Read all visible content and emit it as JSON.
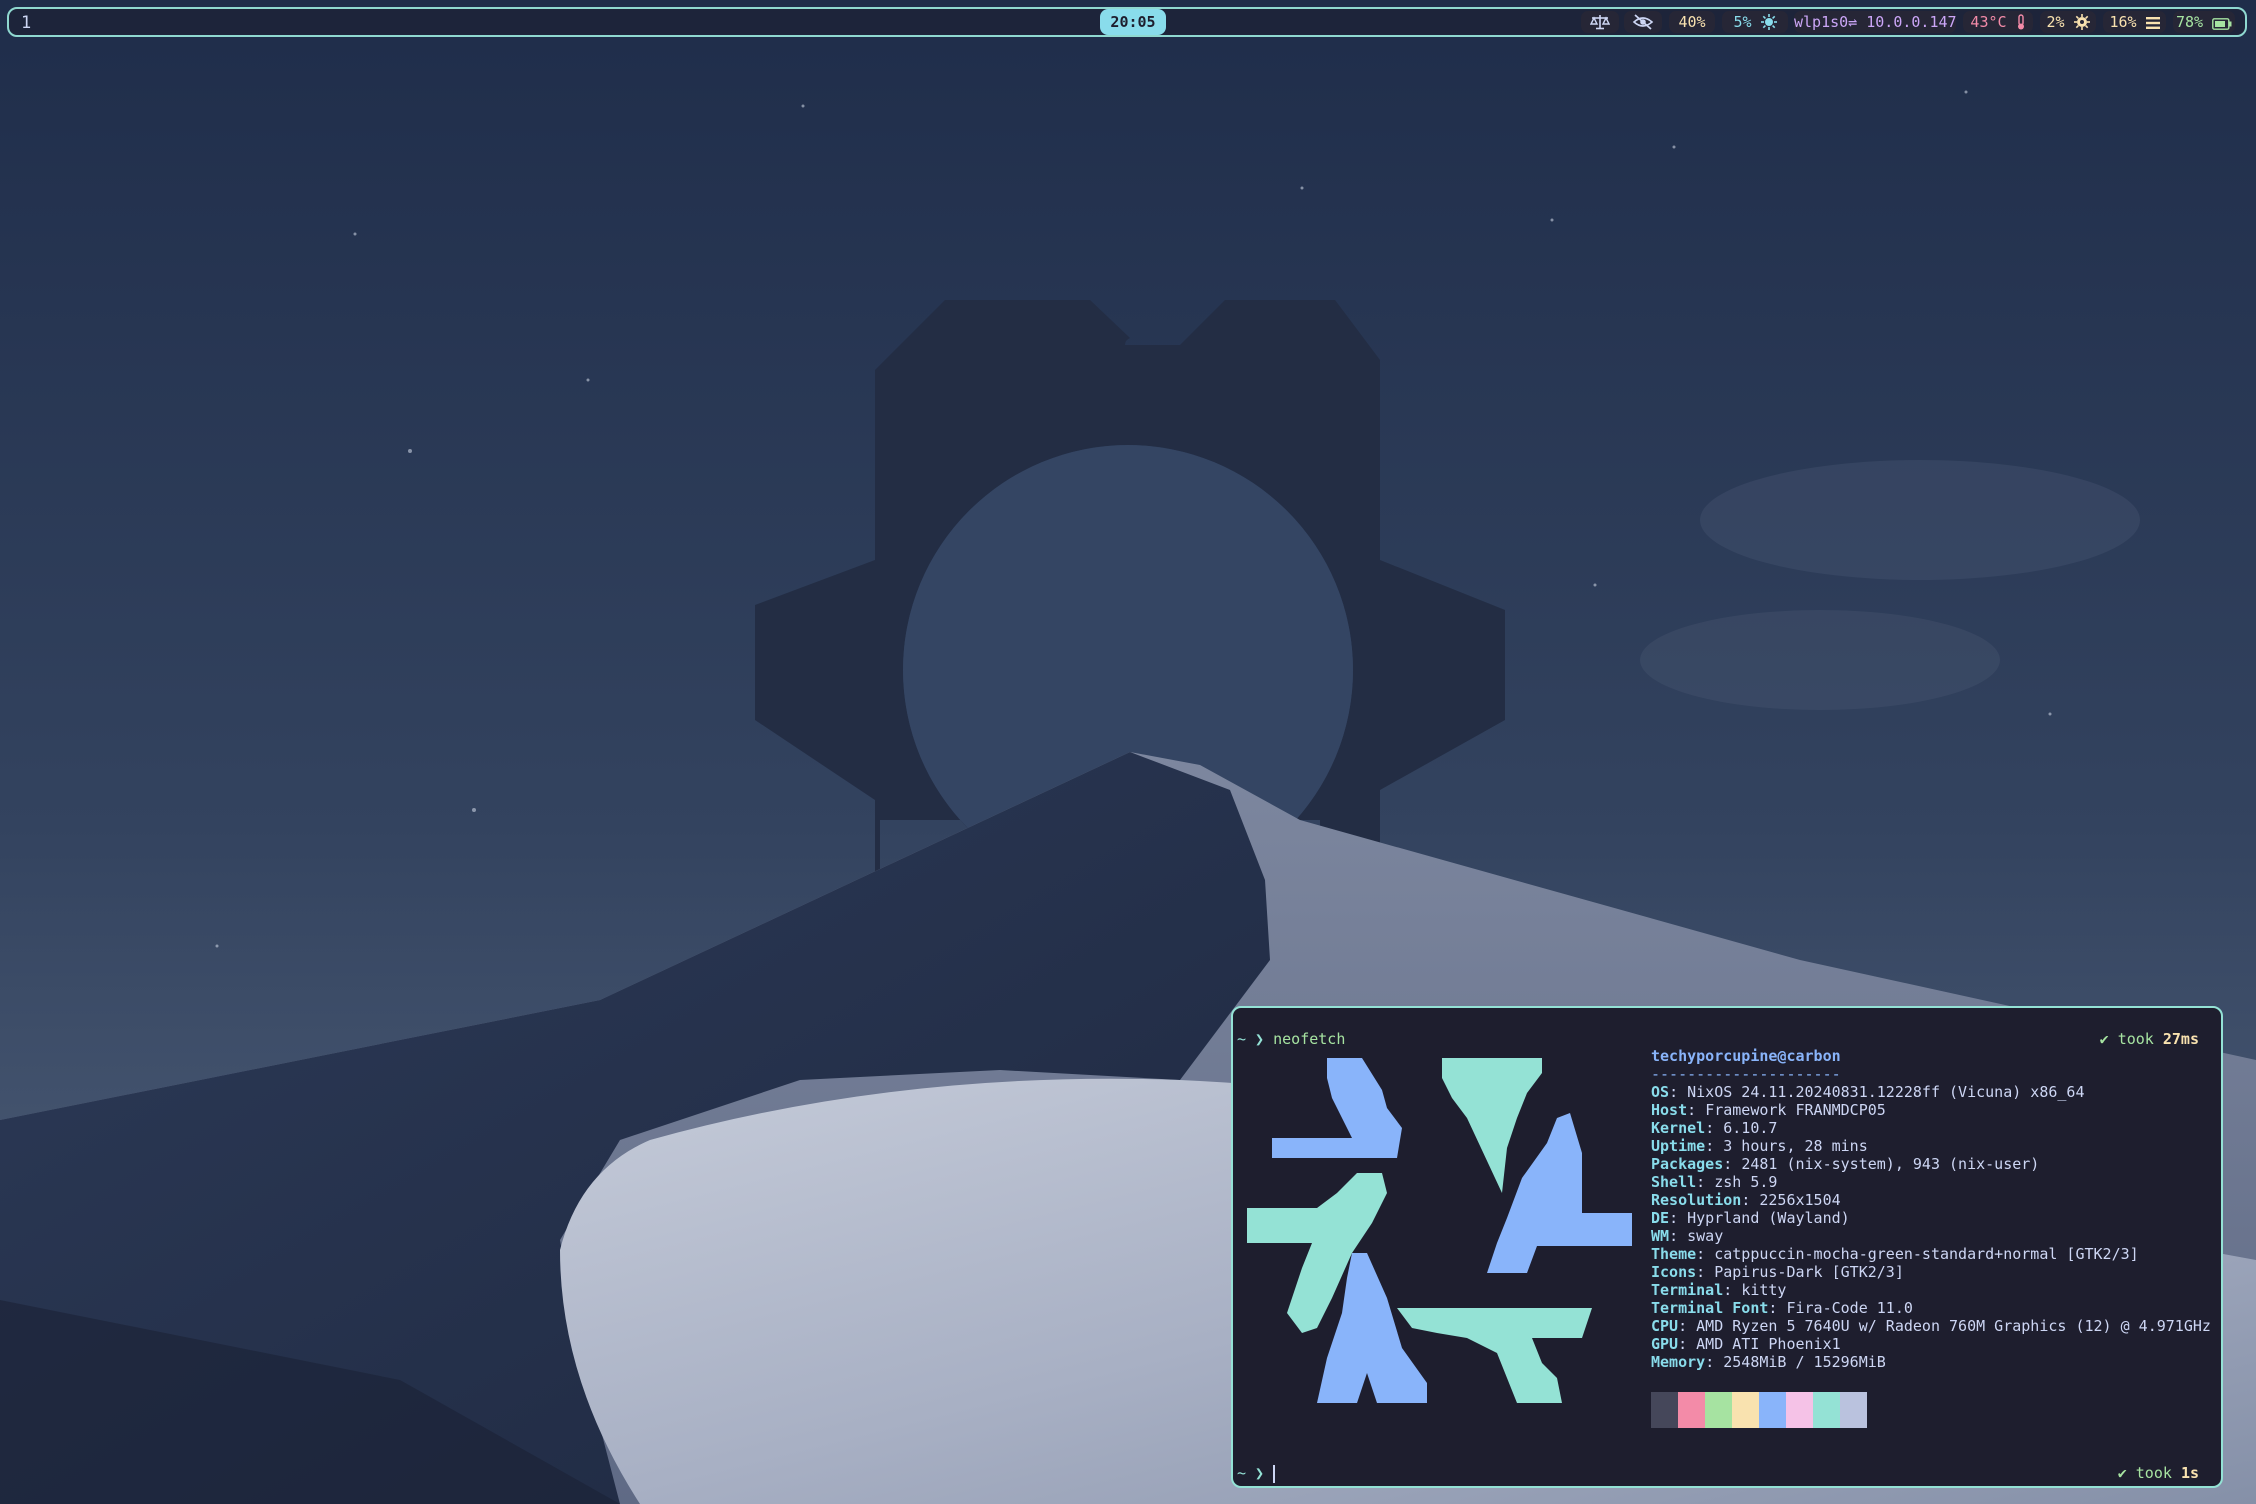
{
  "topbar": {
    "workspace": "1",
    "clock": "20:05",
    "modules": {
      "idle_icon": "scale-icon",
      "eye_icon": "eye-off-icon",
      "volume": "40%",
      "brightness": "5%",
      "brightness_icon": "sun-icon",
      "network": "wlp1s0⇌ 10.0.0.147",
      "temperature": "43°C",
      "temperature_icon": "thermometer-icon",
      "cpu": "2%",
      "cpu_icon": "cpu-icon",
      "memory": "16%",
      "memory_icon": "memory-icon",
      "battery": "78%",
      "battery_icon": "battery-icon"
    }
  },
  "terminal": {
    "prompt_symbol": "~ ❯",
    "command": "neofetch",
    "took_label": "✔ took",
    "took_first": "27ms",
    "took_second": "1s",
    "fetch": {
      "title": "techyporcupine@carbon",
      "separator": "---------------------",
      "rows": [
        {
          "key": "OS",
          "value": "NixOS 24.11.20240831.12228ff (Vicuna) x86_64"
        },
        {
          "key": "Host",
          "value": "Framework FRANMDCP05"
        },
        {
          "key": "Kernel",
          "value": "6.10.7"
        },
        {
          "key": "Uptime",
          "value": "3 hours, 28 mins"
        },
        {
          "key": "Packages",
          "value": "2481 (nix-system), 943 (nix-user)"
        },
        {
          "key": "Shell",
          "value": "zsh 5.9"
        },
        {
          "key": "Resolution",
          "value": "2256x1504"
        },
        {
          "key": "DE",
          "value": "Hyprland (Wayland)"
        },
        {
          "key": "WM",
          "value": "sway"
        },
        {
          "key": "Theme",
          "value": "catppuccin-mocha-green-standard+normal [GTK2/3]"
        },
        {
          "key": "Icons",
          "value": "Papirus-Dark [GTK2/3]"
        },
        {
          "key": "Terminal",
          "value": "kitty"
        },
        {
          "key": "Terminal Font",
          "value": "Fira-Code 11.0"
        },
        {
          "key": "CPU",
          "value": "AMD Ryzen 5 7640U w/ Radeon 760M Graphics (12) @ 4.971GHz"
        },
        {
          "key": "GPU",
          "value": "AMD ATI Phoenix1"
        },
        {
          "key": "Memory",
          "value": "2548MiB / 15296MiB"
        }
      ],
      "palette": [
        "#45475a",
        "#f38ba8",
        "#a6e3a1",
        "#f9e2af",
        "#89b4fa",
        "#f5c2e7",
        "#94e2d5",
        "#bac2de"
      ]
    },
    "logo_colors": {
      "blue": "#89b4fa",
      "teal": "#94e2d5"
    }
  },
  "wallpaper": {
    "sky_top": "#263552",
    "sky_bottom": "#4a5a78",
    "gear_color": "#232d44",
    "dune_dark": "#263450",
    "dune_light": "#a9b0c4"
  }
}
